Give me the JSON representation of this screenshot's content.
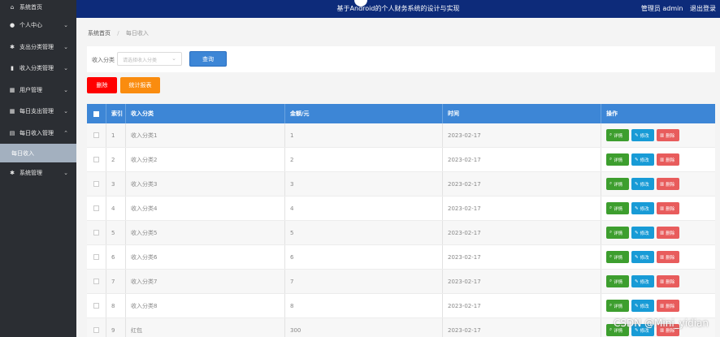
{
  "header": {
    "title": "基于Android的个人财务系统的设计与实现",
    "user": "管理员 admin",
    "logout": "退出登录"
  },
  "sidebar": {
    "items": [
      {
        "label": "系统首页",
        "icon": "home-icon"
      },
      {
        "label": "个人中心",
        "icon": "user-icon"
      },
      {
        "label": "支出分类管理",
        "icon": "settings-icon"
      },
      {
        "label": "收入分类管理",
        "icon": "bar-chart-icon"
      },
      {
        "label": "用户管理",
        "icon": "grid-icon"
      },
      {
        "label": "每日支出管理",
        "icon": "grid-icon"
      },
      {
        "label": "每日收入管理",
        "icon": "list-icon"
      },
      {
        "label": "系统管理",
        "icon": "settings-icon"
      }
    ],
    "sub_active": "每日收入"
  },
  "breadcrumb": {
    "home": "系统首页",
    "current": "每日收入"
  },
  "search": {
    "label": "收入分类",
    "placeholder": "请选择收入分类",
    "query_button": "查询"
  },
  "actions": {
    "delete": "删除",
    "report": "统计报表"
  },
  "table": {
    "headers": [
      "索引",
      "收入分类",
      "金额/元",
      "时间",
      "操作"
    ],
    "rows": [
      {
        "index": "1",
        "category": "收入分类1",
        "amount": "1",
        "time": "2023-02-17"
      },
      {
        "index": "2",
        "category": "收入分类2",
        "amount": "2",
        "time": "2023-02-17"
      },
      {
        "index": "3",
        "category": "收入分类3",
        "amount": "3",
        "time": "2023-02-17"
      },
      {
        "index": "4",
        "category": "收入分类4",
        "amount": "4",
        "time": "2023-02-17"
      },
      {
        "index": "5",
        "category": "收入分类5",
        "amount": "5",
        "time": "2023-02-17"
      },
      {
        "index": "6",
        "category": "收入分类6",
        "amount": "6",
        "time": "2023-02-17"
      },
      {
        "index": "7",
        "category": "收入分类7",
        "amount": "7",
        "time": "2023-02-17"
      },
      {
        "index": "8",
        "category": "收入分类8",
        "amount": "8",
        "time": "2023-02-17"
      },
      {
        "index": "9",
        "category": "红包",
        "amount": "300",
        "time": "2023-02-17"
      }
    ],
    "op_labels": {
      "detail": "详情",
      "edit": "修改",
      "delete": "删除"
    }
  },
  "watermark": "CSDN @Mini_yidian",
  "colors": {
    "sidebar_bg": "#2b2e33",
    "header_bg": "#0d2b7a",
    "primary": "#3d86d6",
    "danger": "#ff0000",
    "warning": "#fa8c0f",
    "success": "#3d9e2e",
    "info": "#189bd6"
  }
}
